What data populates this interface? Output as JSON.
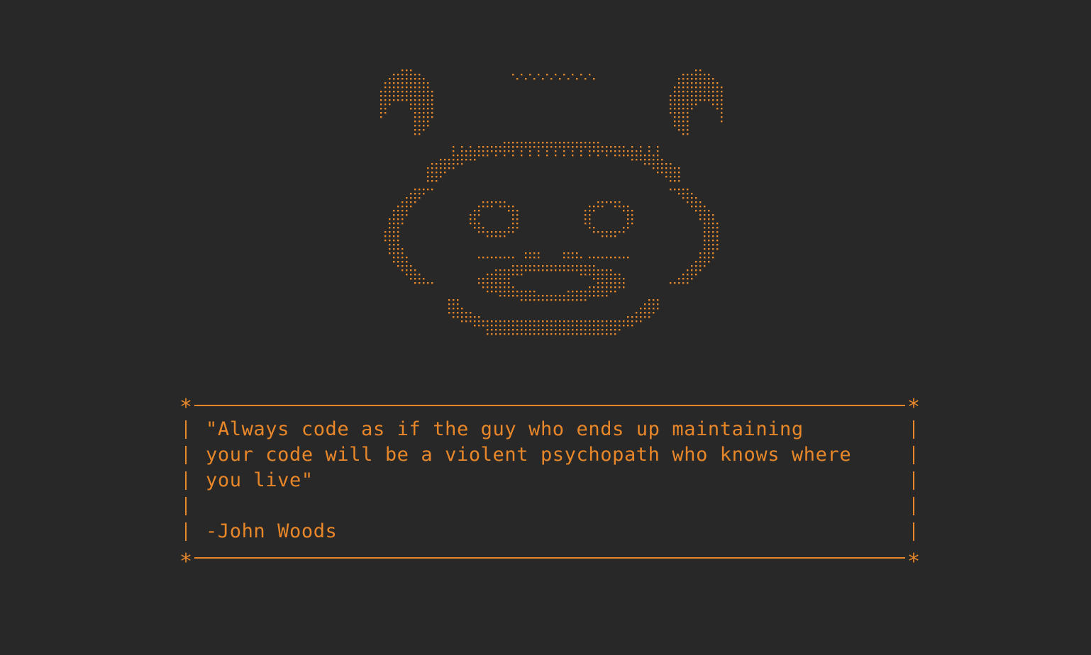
{
  "theme": {
    "background": "#282828",
    "foreground": "#e8872a"
  },
  "ascii_art": {
    "subject": "raccoon-face"
  },
  "quote": {
    "lines": [
      "\"Always code as if the guy who ends up maintaining",
      "your code will be a violent psychopath who knows where",
      "you live\"",
      "",
      "-John Woods"
    ],
    "border_corner": "*"
  }
}
